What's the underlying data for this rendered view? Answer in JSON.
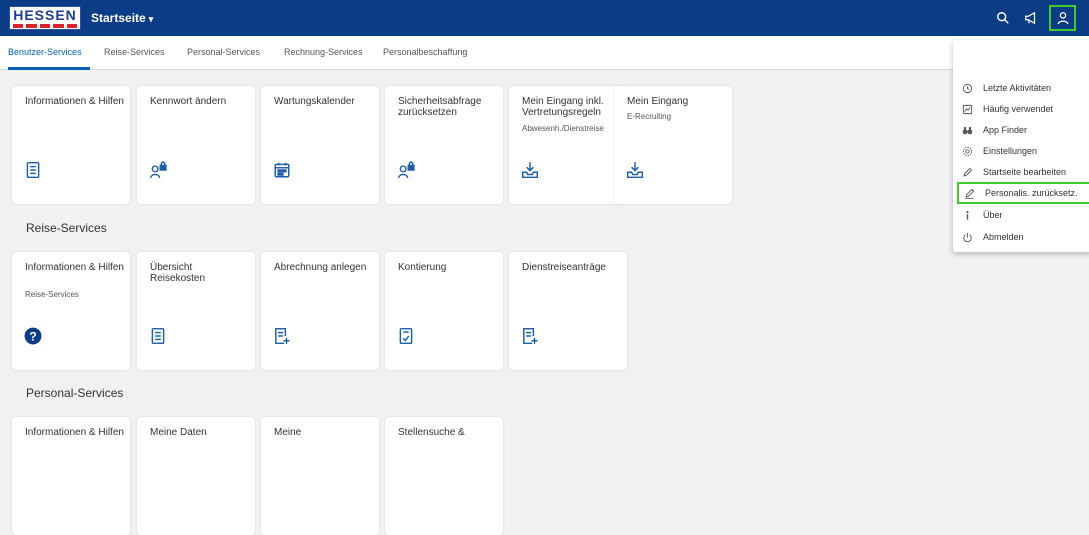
{
  "shell": {
    "logo_text": "HESSEN",
    "title": "Startseite",
    "caret": "▾"
  },
  "tabs": [
    {
      "label": "Benutzer-Services",
      "active": true
    },
    {
      "label": "Reise-Services"
    },
    {
      "label": "Personal-Services"
    },
    {
      "label": "Rechnung-Services"
    },
    {
      "label": "Personalbeschaffung"
    }
  ],
  "sections": [
    {
      "title": ""
    },
    {
      "title": "Reise-Services"
    },
    {
      "title": "Personal-Services"
    }
  ],
  "tiles_row1": [
    {
      "title": "Informationen & Hilfen",
      "subtitle": "",
      "icon": "list-icon"
    },
    {
      "title": "Kennwort ändern",
      "subtitle": "",
      "icon": "user-lock-icon"
    },
    {
      "title": "Wartungskalender",
      "subtitle": "",
      "icon": "calendar-icon"
    },
    {
      "title": "Sicherheitsabfrage zurücksetzen",
      "subtitle": "",
      "icon": "user-lock-icon"
    },
    {
      "title": "Mein Eingang inkl. Vertretungsregeln",
      "subtitle": "Abwesenh./Dienstreise",
      "icon": "inbox-download-icon"
    },
    {
      "title": "Mein Eingang",
      "subtitle": "E-Recruiting",
      "icon": "inbox-download-icon"
    }
  ],
  "tiles_row2": [
    {
      "title": "Informationen & Hilfen",
      "subtitle": "Reise-Services",
      "icon": "help-circle-icon"
    },
    {
      "title": "Übersicht Reisekosten",
      "subtitle": "",
      "icon": "list-icon"
    },
    {
      "title": "Abrechnung anlegen",
      "subtitle": "",
      "icon": "add-document-icon"
    },
    {
      "title": "Kontierung",
      "subtitle": "",
      "icon": "checklist-document-icon"
    },
    {
      "title": "Dienstreiseanträge",
      "subtitle": "",
      "icon": "add-document-icon"
    }
  ],
  "tiles_row3": [
    {
      "title": "Informationen & Hilfen"
    },
    {
      "title": "Meine Daten"
    },
    {
      "title": "Meine"
    },
    {
      "title": "Stellensuche &"
    }
  ],
  "menu": [
    {
      "label": "Letzte Aktivitäten",
      "icon": "history-icon"
    },
    {
      "label": "Häufig verwendet",
      "icon": "frequent-icon"
    },
    {
      "label": "App Finder",
      "icon": "binoculars-icon"
    },
    {
      "label": "Einstellungen",
      "icon": "gear-icon"
    },
    {
      "label": "Startseite bearbeiten",
      "icon": "pencil-icon"
    },
    {
      "label": "Personalis. zurücksetz.",
      "icon": "pencil-reset-icon"
    },
    {
      "label": "Über",
      "icon": "info-icon"
    },
    {
      "label": "Abmelden",
      "icon": "power-icon"
    }
  ],
  "colors": {
    "shellbar": "#0b3c86",
    "accent": "#0a5fb4",
    "highlight": "#3fca2d"
  }
}
